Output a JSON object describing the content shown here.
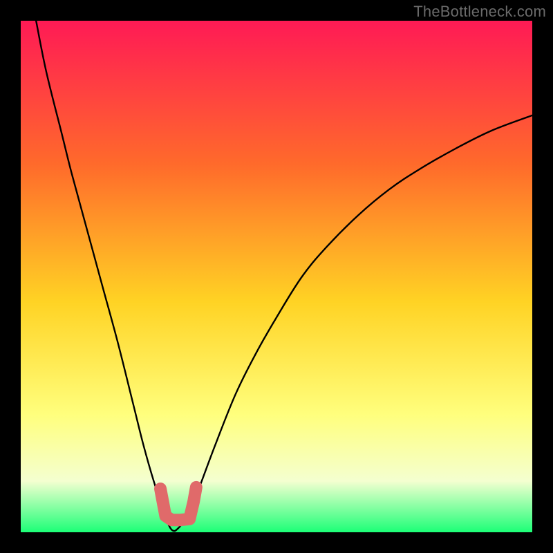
{
  "watermark": "TheBottleneck.com",
  "colors": {
    "frame_bg": "#000000",
    "grad_top": "#ff1a55",
    "grad_mid1": "#ff6a2b",
    "grad_mid2": "#ffd324",
    "grad_mid3": "#ffff7d",
    "grad_mid4": "#f4ffd0",
    "grad_bottom": "#1cff77",
    "curve_stroke": "#000000",
    "marker_stroke": "#e06a6a"
  },
  "chart_data": {
    "type": "line",
    "title": "",
    "xlabel": "",
    "ylabel": "",
    "xlim": [
      0,
      100
    ],
    "ylim": [
      0,
      100
    ],
    "note": "V-shaped bottleneck curve. y represents bottleneck % (0 optimal, 100 worst). Minimum near x≈30. Small pink marker segment near the trough (short L-shape).",
    "series": [
      {
        "name": "bottleneck-curve",
        "x": [
          3,
          5,
          8,
          10,
          13,
          16,
          19,
          22,
          24,
          26,
          28,
          29.5,
          31,
          33,
          35,
          38,
          42,
          46,
          50,
          55,
          60,
          66,
          72,
          78,
          85,
          92,
          100
        ],
        "y": [
          100,
          90,
          78,
          70,
          59,
          48,
          37,
          25,
          17,
          10,
          4,
          0.5,
          1,
          4,
          9,
          17,
          27,
          35,
          42,
          50,
          56,
          62,
          67,
          71,
          75,
          78.5,
          81.5
        ]
      }
    ],
    "markers": {
      "name": "balanced-range-marker",
      "points": [
        {
          "x": 27.3,
          "y": 8.5
        },
        {
          "x": 28.3,
          "y": 3.2
        },
        {
          "x": 29.5,
          "y": 2.4
        },
        {
          "x": 31.2,
          "y": 2.4
        },
        {
          "x": 33.0,
          "y": 2.6
        },
        {
          "x": 33.8,
          "y": 6.0
        },
        {
          "x": 34.3,
          "y": 8.8
        }
      ]
    }
  }
}
